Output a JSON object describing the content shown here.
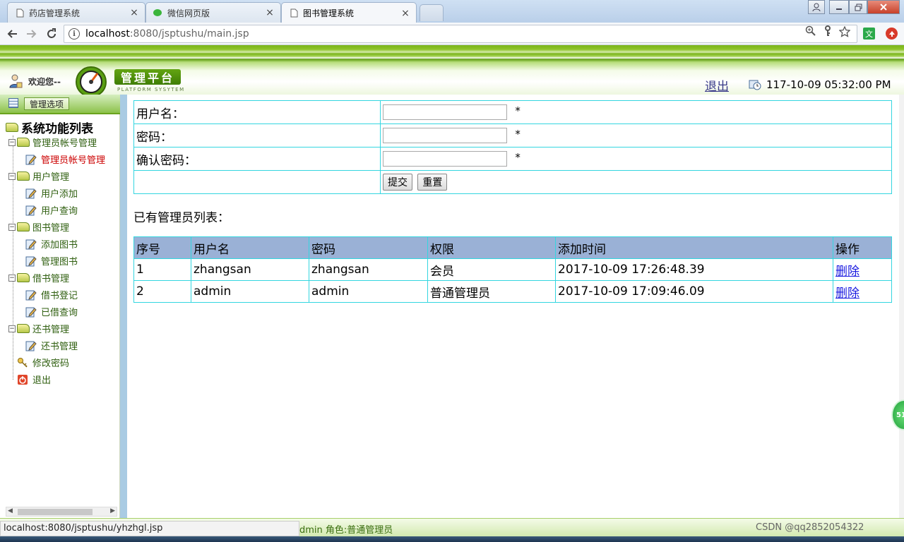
{
  "browser": {
    "tabs": [
      {
        "label": "药店管理系统",
        "close": "×"
      },
      {
        "label": "微信网页版",
        "close": "×"
      },
      {
        "label": "图书管理系统",
        "close": "×"
      }
    ],
    "url_host": "localhost",
    "url_path": ":8080/jsptushu/main.jsp",
    "status_url": "localhost:8080/jsptushu/yhzhgl.jsp",
    "ext_translate": "文"
  },
  "header": {
    "welcome": "欢迎您--",
    "logo_title": "管理平台",
    "logo_subtitle": "PLATFORM SYSYTEM",
    "logout": "退出",
    "datetime": "117-10-09 05:32:00 PM"
  },
  "sidebar": {
    "options_button": "管理选项",
    "tree_title": "系统功能列表",
    "groups": [
      {
        "label": "管理员帐号管理",
        "items": [
          "管理员帐号管理"
        ]
      },
      {
        "label": "用户管理",
        "items": [
          "用户添加",
          "用户查询"
        ]
      },
      {
        "label": "图书管理",
        "items": [
          "添加图书",
          "管理图书"
        ]
      },
      {
        "label": "借书管理",
        "items": [
          "借书登记",
          "已借查询"
        ]
      },
      {
        "label": "还书管理",
        "items": [
          "还书管理"
        ]
      }
    ],
    "change_password": "修改密码",
    "exit": "退出"
  },
  "form": {
    "username_label": "用户名：",
    "password_label": "密码：",
    "confirm_label": "确认密码：",
    "required_mark": "*",
    "username_value": "",
    "password_value": "",
    "confirm_value": "",
    "submit": "提交",
    "reset": "重置"
  },
  "admin_list": {
    "title": "已有管理员列表：",
    "columns": [
      "序号",
      "用户名",
      "密码",
      "权限",
      "添加时间",
      "操作"
    ],
    "rows": [
      [
        "1",
        "zhangsan",
        "zhangsan",
        "会员",
        "2017-10-09 17:26:48.39",
        "删除"
      ],
      [
        "2",
        "admin",
        "admin",
        "普通管理员",
        "2017-10-09 17:09:46.09",
        "删除"
      ]
    ]
  },
  "footer": {
    "role": "dmin  角色:普通管理员",
    "right": "CSDN @qq2852054322"
  },
  "float_badge": "51",
  "colors": {
    "header_green": "#7ab41a",
    "table_border": "#33d6e0",
    "table_header": "#9ab1d6",
    "link_blue": "#1a1ae0",
    "active_leaf": "#cc0000"
  }
}
